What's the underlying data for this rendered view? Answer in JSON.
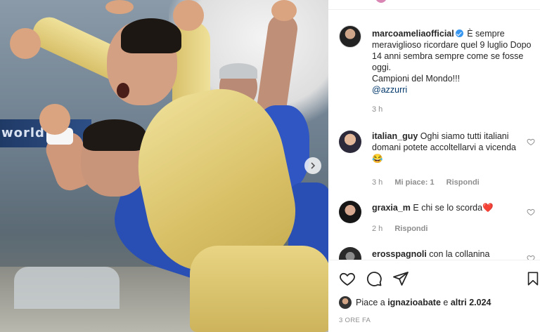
{
  "post": {
    "author": "marcoameliaofficial",
    "caption": "È sempre meraviglioso ricordare quel 9 luglio Dopo 14 anni sembra sempre come se fosse oggi.",
    "caption_line2": "Campioni del Mondo!!!",
    "mention": "@azzurri",
    "time": "3 h",
    "image_banner_text": "world"
  },
  "comments": [
    {
      "username": "italian_guy",
      "text": "Oghi siamo tutti italiani domani potete accoltellarvi a vicenda 😂",
      "time": "3 h",
      "likes": "Mi piace: 1",
      "reply": "Rispondi"
    },
    {
      "username": "graxia_m",
      "text": "E chi se lo scorda",
      "emoji": "❤️",
      "time": "2 h",
      "reply": "Rispondi"
    },
    {
      "username": "erosspagnoli",
      "text": "con la collanina"
    }
  ],
  "likes": {
    "prefix": "Piace a",
    "user": "ignazioabate",
    "connector": "e",
    "others": "altri 2.024"
  },
  "posted_ago": "3 ORE FA",
  "icons": [
    "heart-icon",
    "comment-icon",
    "share-icon",
    "bookmark-icon",
    "chevron-right-icon",
    "verified-icon"
  ],
  "colors": {
    "verified": "#3897f0",
    "mention": "#00376b",
    "meta": "#8e8e8e",
    "heart_red": "#ed4956"
  }
}
